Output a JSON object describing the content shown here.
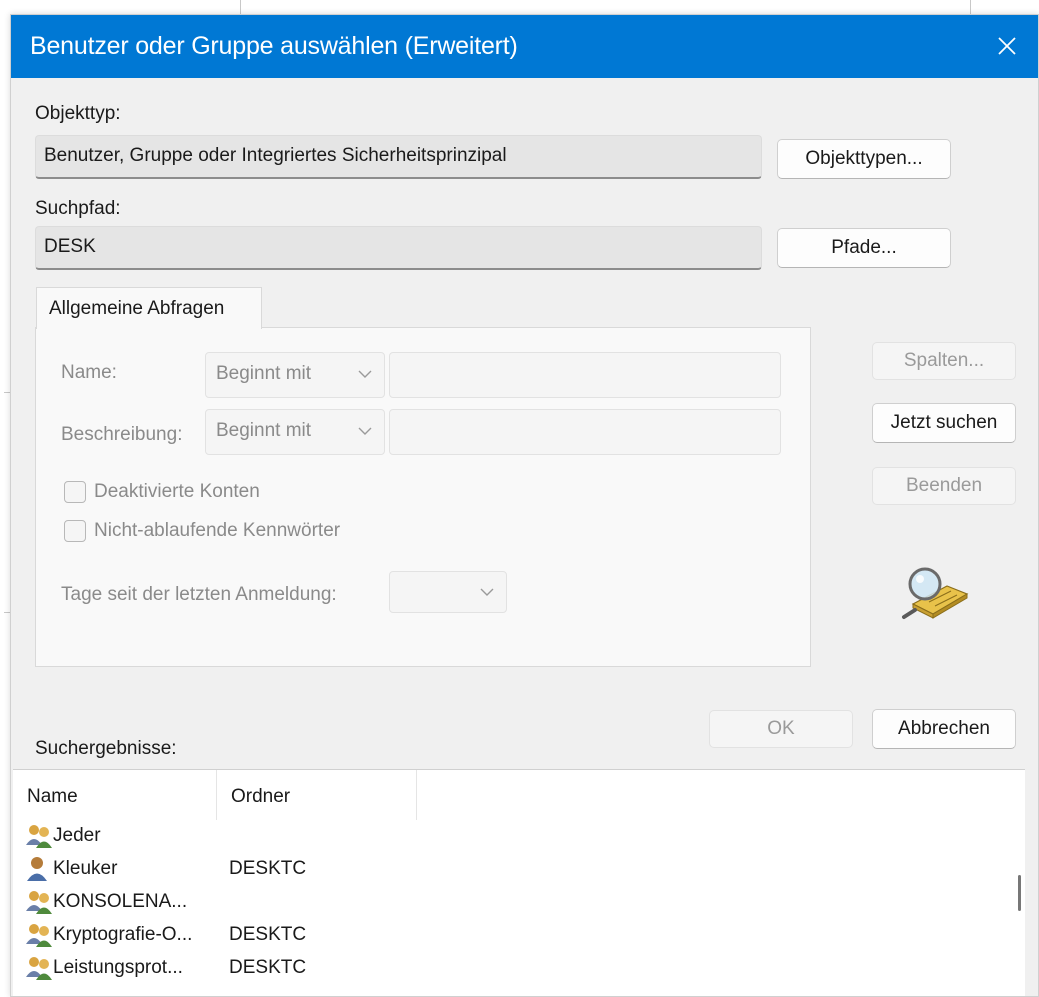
{
  "dialog": {
    "title": "Benutzer oder Gruppe auswählen (Erweitert)",
    "object_type_label": "Objekttyp:",
    "object_type_value": "Benutzer, Gruppe oder Integriertes Sicherheitsprinzipal",
    "object_types_button": "Objekttypen...",
    "search_path_label": "Suchpfad:",
    "search_path_value": "DESK",
    "paths_button": "Pfade..."
  },
  "tab": {
    "label": "Allgemeine Abfragen",
    "name_label": "Name:",
    "name_operator": "Beginnt mit",
    "description_label": "Beschreibung:",
    "description_operator": "Beginnt mit",
    "disabled_accounts_label": "Deaktivierte Konten",
    "non_expiring_passwords_label": "Nicht-ablaufende Kennwörter",
    "days_since_logon_label": "Tage seit der letzten Anmeldung:"
  },
  "actions": {
    "columns_button": "Spalten...",
    "search_now_button": "Jetzt suchen",
    "stop_button": "Beenden",
    "ok_button": "OK",
    "cancel_button": "Abbrechen"
  },
  "results": {
    "label": "Suchergebnisse:",
    "columns": [
      "Name",
      "Ordner"
    ],
    "rows": [
      {
        "name": "Jeder",
        "folder": "",
        "icon": "group-icon"
      },
      {
        "name": "Kleuker",
        "folder": "DESKTC",
        "icon": "user-icon"
      },
      {
        "name": "KONSOLENA...",
        "folder": "",
        "icon": "group-icon"
      },
      {
        "name": "Kryptografie-O...",
        "folder": "DESKTC",
        "icon": "group-icon"
      },
      {
        "name": "Leistungsprot...",
        "folder": "DESKTC",
        "icon": "group-icon"
      }
    ]
  },
  "colors": {
    "titlebar": "#0078d4",
    "dialog_background": "#f0f0f0",
    "disabled_text": "#8a8a8a"
  }
}
